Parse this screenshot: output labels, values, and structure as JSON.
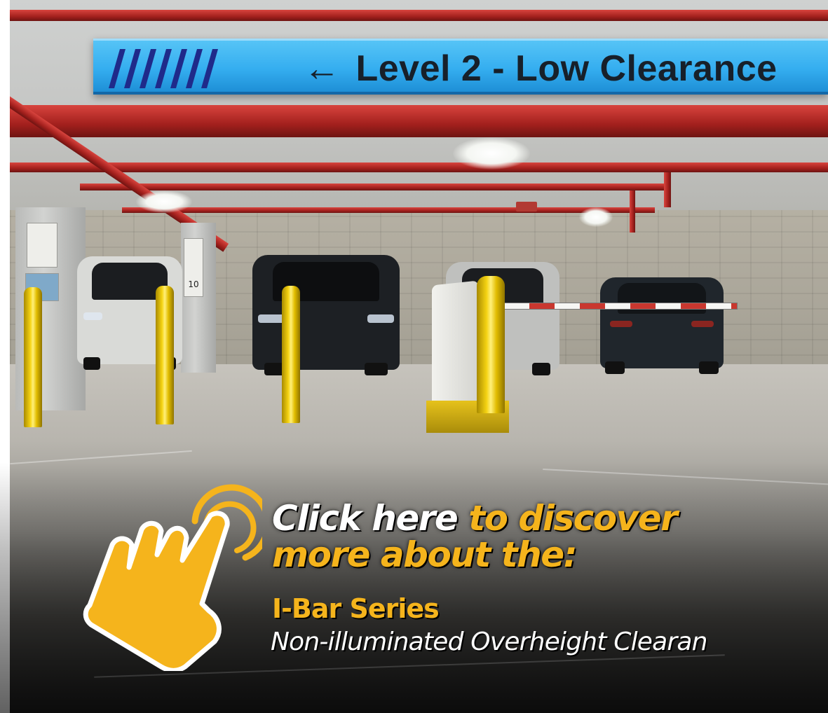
{
  "photo": {
    "overhead_sign": {
      "arrow": "←",
      "text": "Level 2 - Low Clearance"
    },
    "pillar_number": "10"
  },
  "cta": {
    "icon": "tap-hand-icon",
    "line1_white": "Click here",
    "line1_gold": " to discover",
    "line2": "more about the:",
    "product_name": "I-Bar Series",
    "product_description": "Non-illuminated Overheight Clearan"
  },
  "colors": {
    "sign_blue": "#35aef0",
    "accent_gold": "#f5b41c",
    "cta_text_white": "#ffffff",
    "pipe_red": "#a3201d",
    "bollard_yellow": "#f5d312"
  }
}
